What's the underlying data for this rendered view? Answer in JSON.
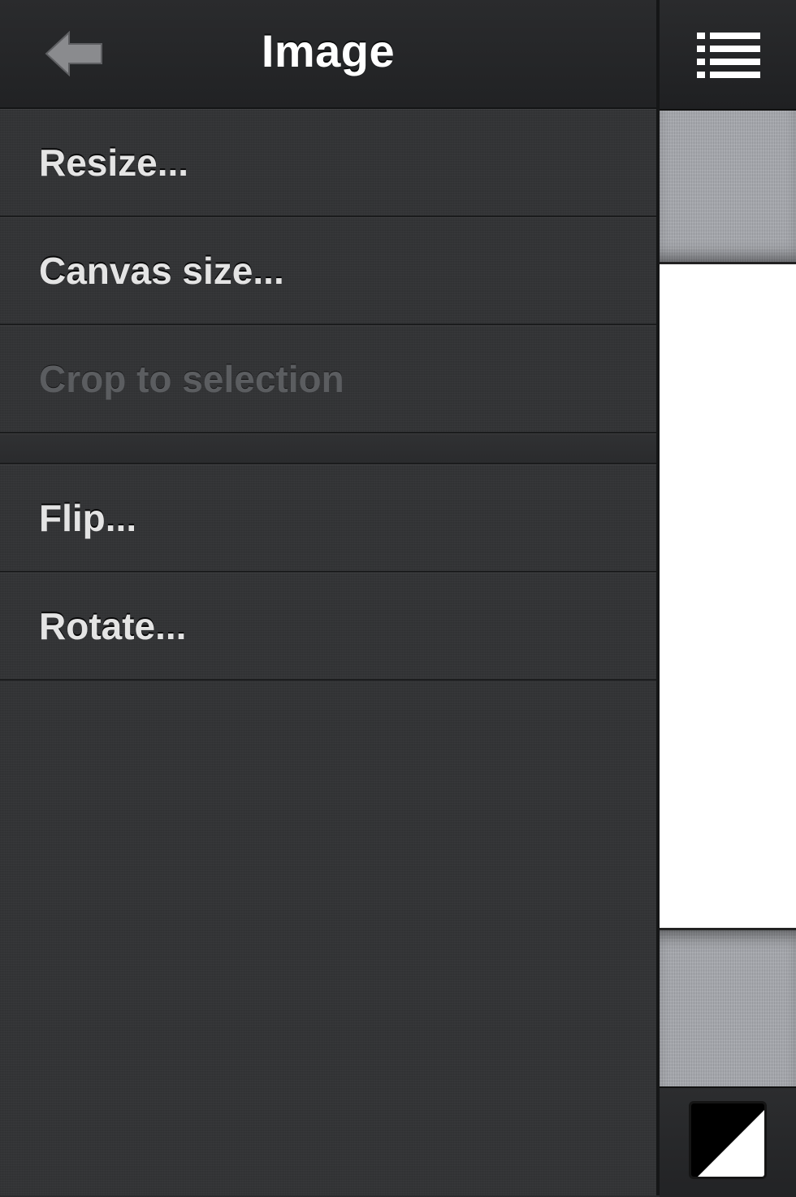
{
  "header": {
    "title": "Image",
    "back_icon": "back-arrow-icon"
  },
  "menu": {
    "items": [
      {
        "label": "Resize...",
        "enabled": true
      },
      {
        "label": "Canvas size...",
        "enabled": true
      },
      {
        "label": "Crop to selection",
        "enabled": false
      },
      {
        "label": "Flip...",
        "enabled": true
      },
      {
        "label": "Rotate...",
        "enabled": true
      }
    ]
  },
  "toolbar": {
    "list_icon": "list-icon",
    "color_icon": "primary-secondary-color-icon"
  },
  "colors": {
    "panel_bg": "#333436",
    "text_enabled": "#e4e4e4",
    "text_disabled": "#5b5d60",
    "canvas": "#ffffff",
    "primary_color": "#000000",
    "secondary_color": "#ffffff"
  }
}
